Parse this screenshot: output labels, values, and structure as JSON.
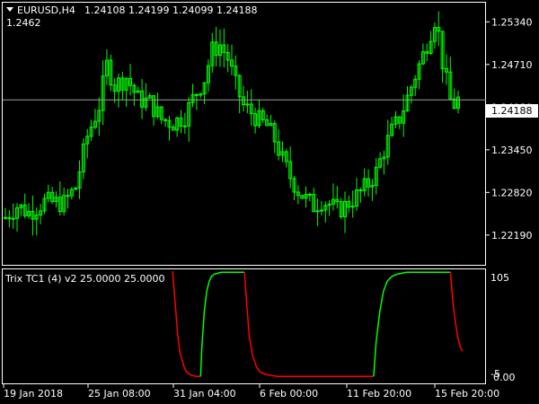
{
  "header": {
    "symbol": "EURUSD,H4",
    "ohlc": "1.24108 1.24199 1.24099 1.24188",
    "subline": "1.2462"
  },
  "indicator": {
    "title": "Trix TC1 (4) v2 25.0000 25.0000",
    "axis_top": "105",
    "axis_bottom": "0.00",
    "axis_bottom_under": "-5"
  },
  "colors": {
    "background": "#000000",
    "frame": "#ffffff",
    "candles": "#00ff00",
    "bid_line": "#a0a0a0",
    "trix_up": "#00ff00",
    "trix_down": "#ff0000"
  },
  "chart_data": [
    {
      "type": "candlestick",
      "title": "EURUSD,H4",
      "ylim": [
        1.2175,
        1.2561
      ],
      "y_ticks": [
        "1.25340",
        "1.24710",
        "1.24080",
        "1.23450",
        "1.22820",
        "1.22190"
      ],
      "x_ticks": [
        "19 Jan 2018",
        "25 Jan 08:00",
        "31 Jan 04:00",
        "6 Feb 00:00",
        "11 Feb 20:00",
        "15 Feb 20:00"
      ],
      "current_price": "1.24188",
      "current_value": 1.24188,
      "close_path": [
        [
          0,
          1.2245
        ],
        [
          3,
          1.2262
        ],
        [
          6,
          1.2252
        ],
        [
          10,
          1.2268
        ],
        [
          15,
          1.2266
        ],
        [
          18,
          1.229
        ],
        [
          21,
          1.2365
        ],
        [
          24,
          1.241
        ],
        [
          26,
          1.247
        ],
        [
          28,
          1.244
        ],
        [
          31,
          1.2452
        ],
        [
          34,
          1.242
        ],
        [
          37,
          1.2415
        ],
        [
          40,
          1.239
        ],
        [
          43,
          1.2385
        ],
        [
          46,
          1.2395
        ],
        [
          48,
          1.242
        ],
        [
          51,
          1.245
        ],
        [
          53,
          1.2492
        ],
        [
          55,
          1.25
        ],
        [
          57,
          1.248
        ],
        [
          59,
          1.244
        ],
        [
          61,
          1.241
        ],
        [
          63,
          1.24
        ],
        [
          65,
          1.2388
        ],
        [
          67,
          1.238
        ],
        [
          69,
          1.236
        ],
        [
          71,
          1.233
        ],
        [
          73,
          1.2305
        ],
        [
          75,
          1.2285
        ],
        [
          77,
          1.2272
        ],
        [
          79,
          1.2262
        ],
        [
          81,
          1.227
        ],
        [
          83,
          1.2265
        ],
        [
          85,
          1.2255
        ],
        [
          87,
          1.2262
        ],
        [
          89,
          1.2272
        ],
        [
          91,
          1.2282
        ],
        [
          93,
          1.2295
        ],
        [
          95,
          1.2312
        ],
        [
          97,
          1.2345
        ],
        [
          99,
          1.2372
        ],
        [
          101,
          1.2392
        ],
        [
          103,
          1.2422
        ],
        [
          105,
          1.2455
        ],
        [
          107,
          1.2485
        ],
        [
          109,
          1.252
        ],
        [
          110,
          1.2538
        ],
        [
          111,
          1.2515
        ],
        [
          112,
          1.2475
        ],
        [
          113,
          1.2445
        ],
        [
          114,
          1.2418
        ],
        [
          115,
          1.2412
        ],
        [
          116,
          1.2419
        ]
      ],
      "candle_count": 117
    },
    {
      "type": "line",
      "title": "Trix TC1 (4) v2 25.0000 25.0000",
      "ylim": [
        -5,
        106
      ],
      "series": [
        {
          "color": "#ff0000",
          "x": [
            34,
            36,
            38,
            40,
            43,
            45,
            48,
            50,
            53,
            55,
            57
          ],
          "values": [
            105,
            75,
            45,
            25,
            12,
            6,
            3,
            2,
            1,
            1,
            1
          ]
        },
        {
          "color": "#00ff00",
          "x": [
            57,
            58,
            60,
            62,
            64,
            66,
            68,
            71,
            74,
            77,
            80
          ],
          "values": [
            1,
            30,
            65,
            85,
            95,
            100,
            102,
            103,
            104,
            104,
            104
          ]
        },
        {
          "color": "#00ff00",
          "x": [
            80,
            93
          ],
          "values": [
            104,
            104
          ]
        },
        {
          "color": "#ff0000",
          "x": [
            93,
            95,
            97,
            100,
            103,
            106,
            110,
            115,
            120,
            125,
            130,
            135,
            140
          ],
          "values": [
            104,
            70,
            40,
            20,
            10,
            5,
            3,
            2,
            1,
            1,
            1,
            1,
            1
          ]
        },
        {
          "color": "#ff0000",
          "x": [
            140,
            160,
            199
          ],
          "values": [
            1,
            1,
            1
          ]
        },
        {
          "color": "#00ff00",
          "x": [
            199,
            201,
            204,
            207,
            210,
            214,
            218,
            222,
            226,
            232
          ],
          "values": [
            1,
            35,
            65,
            85,
            95,
            100,
            102,
            103,
            104,
            104
          ]
        },
        {
          "color": "#00ff00",
          "x": [
            232,
            262
          ],
          "values": [
            104,
            104
          ]
        },
        {
          "color": "#ff0000",
          "x": [
            262,
            264,
            266,
            268,
            270,
            272
          ],
          "values": [
            104,
            75,
            55,
            40,
            30,
            26
          ]
        }
      ],
      "x_domain": [
        0,
        272
      ]
    }
  ]
}
